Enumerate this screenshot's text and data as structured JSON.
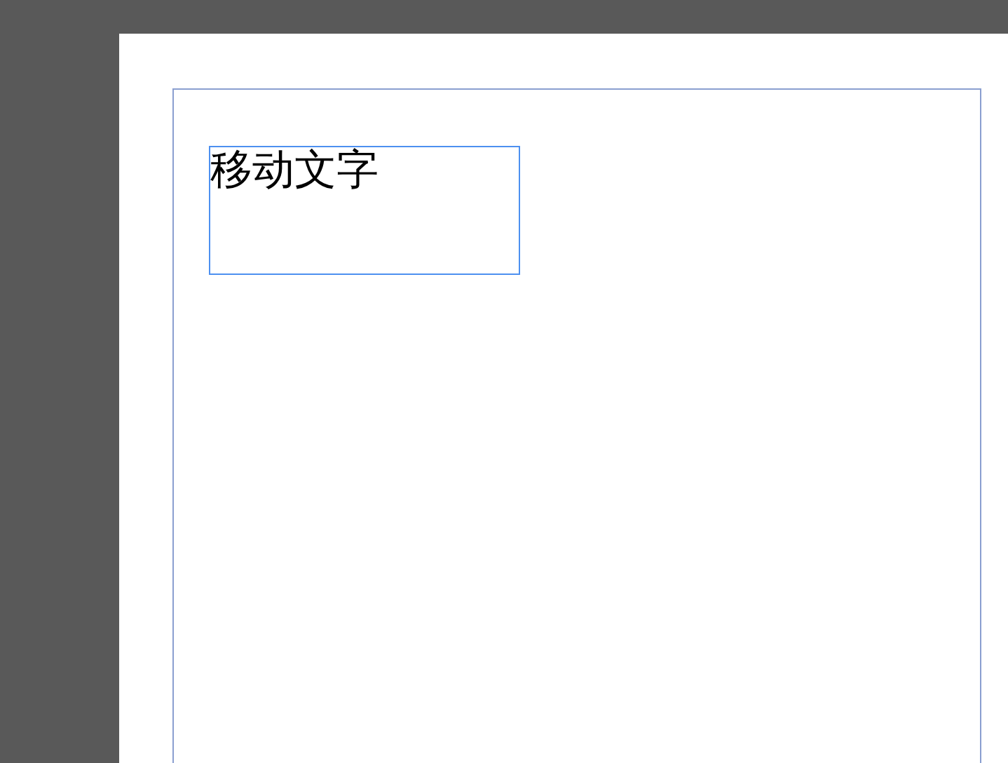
{
  "document": {
    "text_frames": [
      {
        "text": "移动文字",
        "selected": true
      }
    ]
  }
}
